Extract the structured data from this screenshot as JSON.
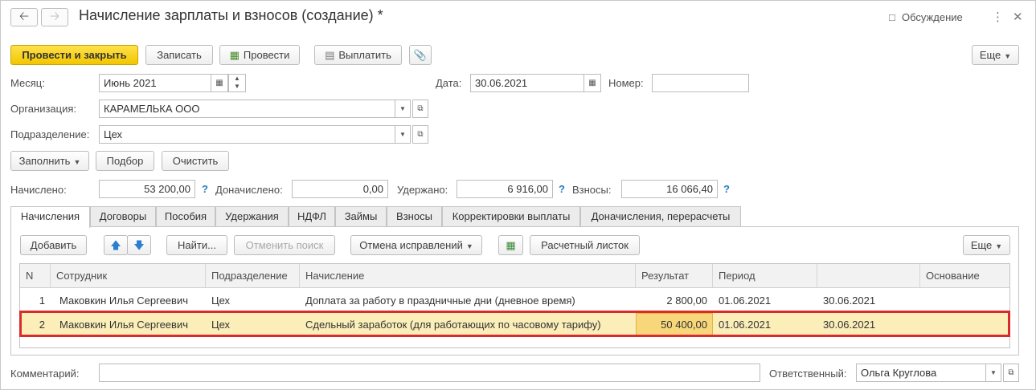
{
  "window": {
    "title": "Начисление зарплаты и взносов (создание) *",
    "discussion_label": "Обсуждение",
    "back_icon": "arrow-left-icon",
    "forward_icon": "arrow-right-icon"
  },
  "toolbar": {
    "post_close": "Провести и закрыть",
    "save": "Записать",
    "post": "Провести",
    "pay": "Выплатить",
    "more": "Еще"
  },
  "header": {
    "month_label": "Месяц:",
    "month_value": "Июнь 2021",
    "date_label": "Дата:",
    "date_value": "30.06.2021",
    "number_label": "Номер:",
    "number_value": "",
    "org_label": "Организация:",
    "org_value": "КАРАМЕЛЬКА ООО",
    "dept_label": "Подразделение:",
    "dept_value": "Цех"
  },
  "actions": {
    "fill": "Заполнить",
    "select": "Подбор",
    "clear": "Очистить"
  },
  "totals": {
    "accrued_label": "Начислено:",
    "accrued_value": "53 200,00",
    "additional_label": "Доначислено:",
    "additional_value": "0,00",
    "withheld_label": "Удержано:",
    "withheld_value": "6 916,00",
    "contrib_label": "Взносы:",
    "contrib_value": "16 066,40",
    "help": "?"
  },
  "tabs": [
    "Начисления",
    "Договоры",
    "Пособия",
    "Удержания",
    "НДФЛ",
    "Займы",
    "Взносы",
    "Корректировки выплаты",
    "Доначисления, перерасчеты"
  ],
  "table_toolbar": {
    "add": "Добавить",
    "find": "Найти...",
    "cancel_search": "Отменить поиск",
    "cancel_corrections": "Отмена исправлений",
    "payslip": "Расчетный листок",
    "more": "Еще"
  },
  "table": {
    "columns": [
      "N",
      "Сотрудник",
      "Подразделение",
      "Начисление",
      "Результат",
      "Период",
      "",
      "Основание"
    ],
    "rows": [
      [
        "1",
        "Маковкин Илья Сергеевич",
        "Цех",
        "Доплата за работу в праздничные дни (дневное время)",
        "2 800,00",
        "01.06.2021",
        "30.06.2021",
        ""
      ],
      [
        "2",
        "Маковкин Илья Сергеевич",
        "Цех",
        "Сдельный заработок (для работающих по часовому тарифу)",
        "50 400,00",
        "01.06.2021",
        "30.06.2021",
        ""
      ]
    ]
  },
  "footer": {
    "comment_label": "Комментарий:",
    "comment_value": "",
    "responsible_label": "Ответственный:",
    "responsible_value": "Ольга Круглова"
  },
  "colors": {
    "primary_button": "#f2c600",
    "selected_row": "#fbeeb9",
    "highlight_cell": "#f7d77a",
    "annotation_box": "#d92b2b",
    "help_mark": "#1d7cc4"
  }
}
